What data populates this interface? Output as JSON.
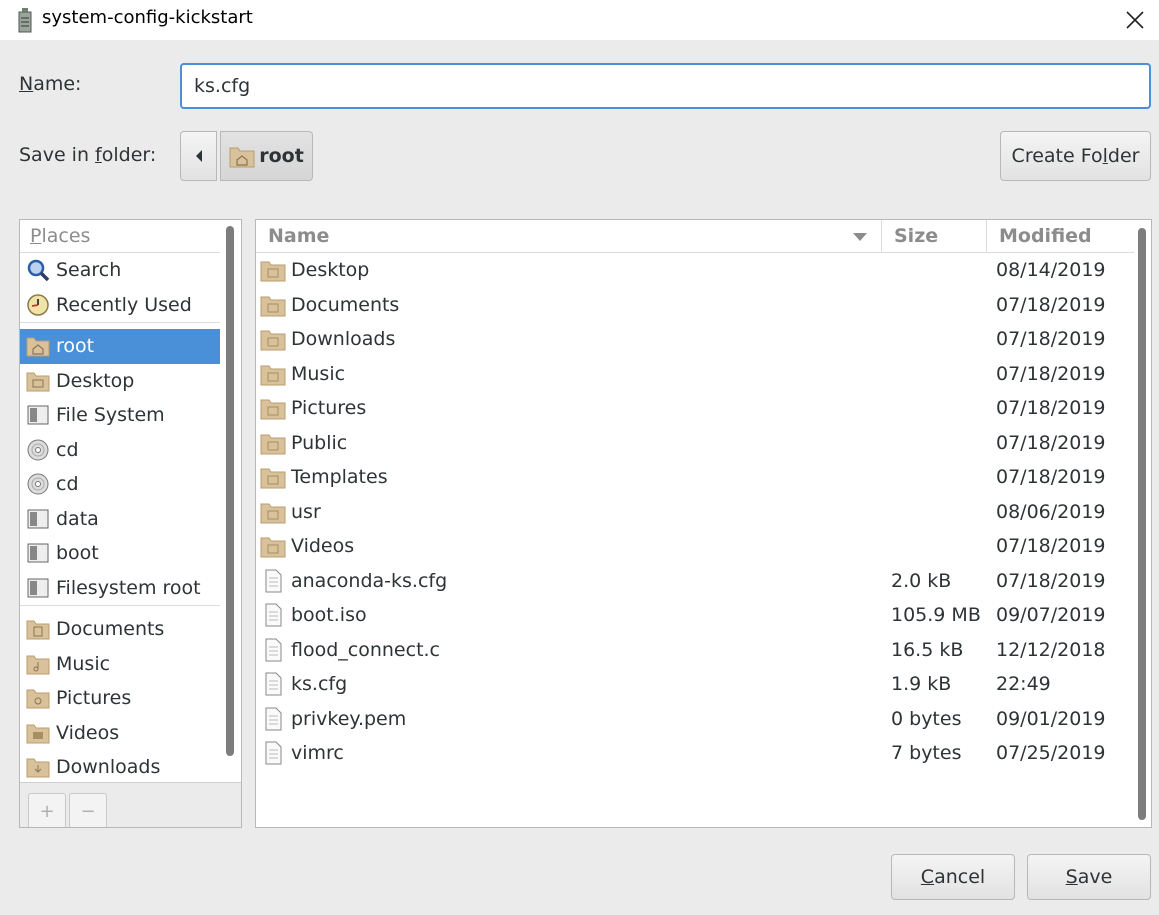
{
  "window": {
    "title": "system-config-kickstart"
  },
  "name_label": {
    "pre": "",
    "mn": "N",
    "post": "ame:"
  },
  "name_input": {
    "value": "ks.cfg"
  },
  "folder_label": {
    "pre": "Save in ",
    "mn": "f",
    "post": "older:"
  },
  "path_bar": {
    "current": "root"
  },
  "create_folder": {
    "pre": "Create Fo",
    "mn": "l",
    "post": "der"
  },
  "places": {
    "header": {
      "mn": "P",
      "post": "laces"
    },
    "items": [
      {
        "label": "Search",
        "icon": "search-icon"
      },
      {
        "label": "Recently Used",
        "icon": "clock-icon"
      },
      {
        "label": "root",
        "icon": "home-folder-icon",
        "selected": true
      },
      {
        "label": "Desktop",
        "icon": "desktop-folder-icon"
      },
      {
        "label": "File System",
        "icon": "drive-icon"
      },
      {
        "label": "cd",
        "icon": "disc-icon"
      },
      {
        "label": "cd",
        "icon": "disc-icon"
      },
      {
        "label": "data",
        "icon": "drive-icon"
      },
      {
        "label": "boot",
        "icon": "drive-icon"
      },
      {
        "label": "Filesystem root",
        "icon": "drive-icon"
      },
      {
        "label": "Documents",
        "icon": "documents-folder-icon"
      },
      {
        "label": "Music",
        "icon": "music-folder-icon"
      },
      {
        "label": "Pictures",
        "icon": "pictures-folder-icon"
      },
      {
        "label": "Videos",
        "icon": "videos-folder-icon"
      },
      {
        "label": "Downloads",
        "icon": "downloads-folder-icon"
      }
    ]
  },
  "file_list": {
    "columns": {
      "name": "Name",
      "size": "Size",
      "modified": "Modified"
    },
    "rows": [
      {
        "name": "Desktop",
        "size": "",
        "modified": "08/14/2019",
        "icon": "folder-icon"
      },
      {
        "name": "Documents",
        "size": "",
        "modified": "07/18/2019",
        "icon": "folder-icon"
      },
      {
        "name": "Downloads",
        "size": "",
        "modified": "07/18/2019",
        "icon": "folder-icon"
      },
      {
        "name": "Music",
        "size": "",
        "modified": "07/18/2019",
        "icon": "folder-icon"
      },
      {
        "name": "Pictures",
        "size": "",
        "modified": "07/18/2019",
        "icon": "folder-icon"
      },
      {
        "name": "Public",
        "size": "",
        "modified": "07/18/2019",
        "icon": "folder-icon"
      },
      {
        "name": "Templates",
        "size": "",
        "modified": "07/18/2019",
        "icon": "folder-icon"
      },
      {
        "name": "usr",
        "size": "",
        "modified": "08/06/2019",
        "icon": "folder-icon"
      },
      {
        "name": "Videos",
        "size": "",
        "modified": "07/18/2019",
        "icon": "folder-icon"
      },
      {
        "name": "anaconda-ks.cfg",
        "size": "2.0 kB",
        "modified": "07/18/2019",
        "icon": "file-icon"
      },
      {
        "name": "boot.iso",
        "size": "105.9 MB",
        "modified": "09/07/2019",
        "icon": "file-icon"
      },
      {
        "name": "flood_connect.c",
        "size": "16.5 kB",
        "modified": "12/12/2018",
        "icon": "file-icon"
      },
      {
        "name": "ks.cfg",
        "size": "1.9 kB",
        "modified": "22:49",
        "icon": "file-icon"
      },
      {
        "name": "privkey.pem",
        "size": "0 bytes",
        "modified": "09/01/2019",
        "icon": "file-icon"
      },
      {
        "name": "vimrc",
        "size": "7 bytes",
        "modified": "07/25/2019",
        "icon": "file-icon"
      }
    ]
  },
  "buttons": {
    "cancel": {
      "mn": "C",
      "post": "ancel"
    },
    "save": {
      "mn": "S",
      "post": "ave"
    }
  },
  "colors": {
    "accent": "#4a90d9",
    "folder": "#d9c29b"
  }
}
